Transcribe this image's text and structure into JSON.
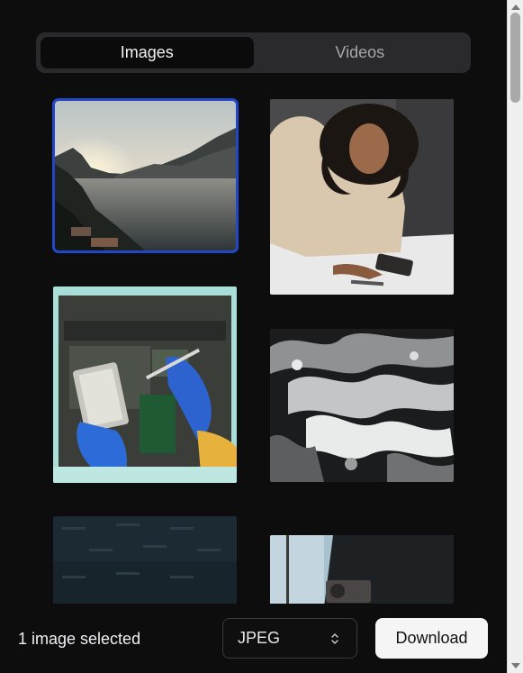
{
  "tabs": {
    "images_label": "Images",
    "videos_label": "Videos",
    "active": "images"
  },
  "gallery": {
    "items": [
      {
        "name": "lake-sunset-image",
        "selected": true
      },
      {
        "name": "woman-with-phone-image",
        "selected": false
      },
      {
        "name": "laptop-repair-image",
        "selected": false
      },
      {
        "name": "ocean-waves-image",
        "selected": false
      },
      {
        "name": "dark-watermark-image",
        "selected": false
      },
      {
        "name": "person-holding-camera-image",
        "selected": false
      }
    ]
  },
  "footer": {
    "selection_text": "1 image selected",
    "format_value": "JPEG",
    "download_label": "Download"
  },
  "colors": {
    "accent": "#2346c9",
    "background": "#0d0d0e",
    "segment_bg": "#2a2a2d"
  }
}
